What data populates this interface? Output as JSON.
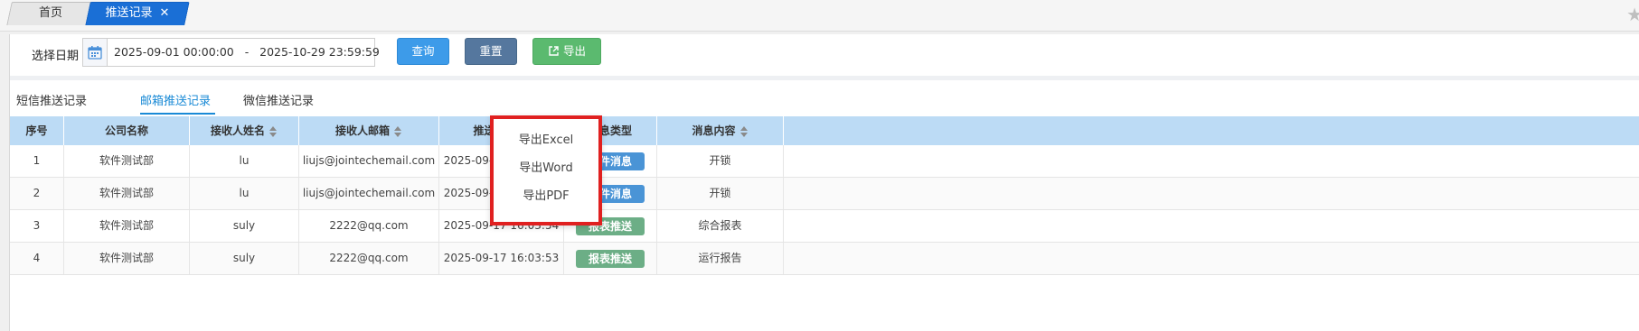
{
  "tabs": {
    "home": "首页",
    "push_records": "推送记录",
    "close_glyph": "✕"
  },
  "toolbar": {
    "date_label": "选择日期",
    "date_start": "2025-09-01 00:00:00",
    "date_sep": "-",
    "date_end": "2025-10-29 23:59:59",
    "query_label": "查询",
    "reset_label": "重置",
    "export_label": "导出"
  },
  "export_menu": {
    "items": [
      "导出Excel",
      "导出Word",
      "导出PDF"
    ]
  },
  "subtabs": {
    "sms": "短信推送记录",
    "email": "邮箱推送记录",
    "wechat": "微信推送记录",
    "active": "email"
  },
  "table": {
    "headers": [
      "序号",
      "公司名称",
      "接收人姓名",
      "接收人邮箱",
      "推送时间",
      "消息类型",
      "消息内容"
    ],
    "rows": [
      {
        "no": "1",
        "company": "软件测试部",
        "name": "lu",
        "email": "liujs@jointechemail.com",
        "time": "2025-09-17 16:11:41",
        "type": "事件消息",
        "type_kind": "event",
        "content": "开锁"
      },
      {
        "no": "2",
        "company": "软件测试部",
        "name": "lu",
        "email": "liujs@jointechemail.com",
        "time": "2025-09-17 16:10:25",
        "type": "事件消息",
        "type_kind": "event",
        "content": "开锁"
      },
      {
        "no": "3",
        "company": "软件测试部",
        "name": "suly",
        "email": "2222@qq.com",
        "time": "2025-09-17 16:03:54",
        "type": "报表推送",
        "type_kind": "report",
        "content": "综合报表"
      },
      {
        "no": "4",
        "company": "软件测试部",
        "name": "suly",
        "email": "2222@qq.com",
        "time": "2025-09-17 16:03:53",
        "type": "报表推送",
        "type_kind": "report",
        "content": "运行报告"
      }
    ]
  },
  "colors": {
    "active_tab": "#1a6fd6",
    "query": "#3d9be9",
    "reset": "#55779e",
    "export": "#5bba6f",
    "highlight_border": "#e02020",
    "header_bg": "#bcdbf5"
  }
}
